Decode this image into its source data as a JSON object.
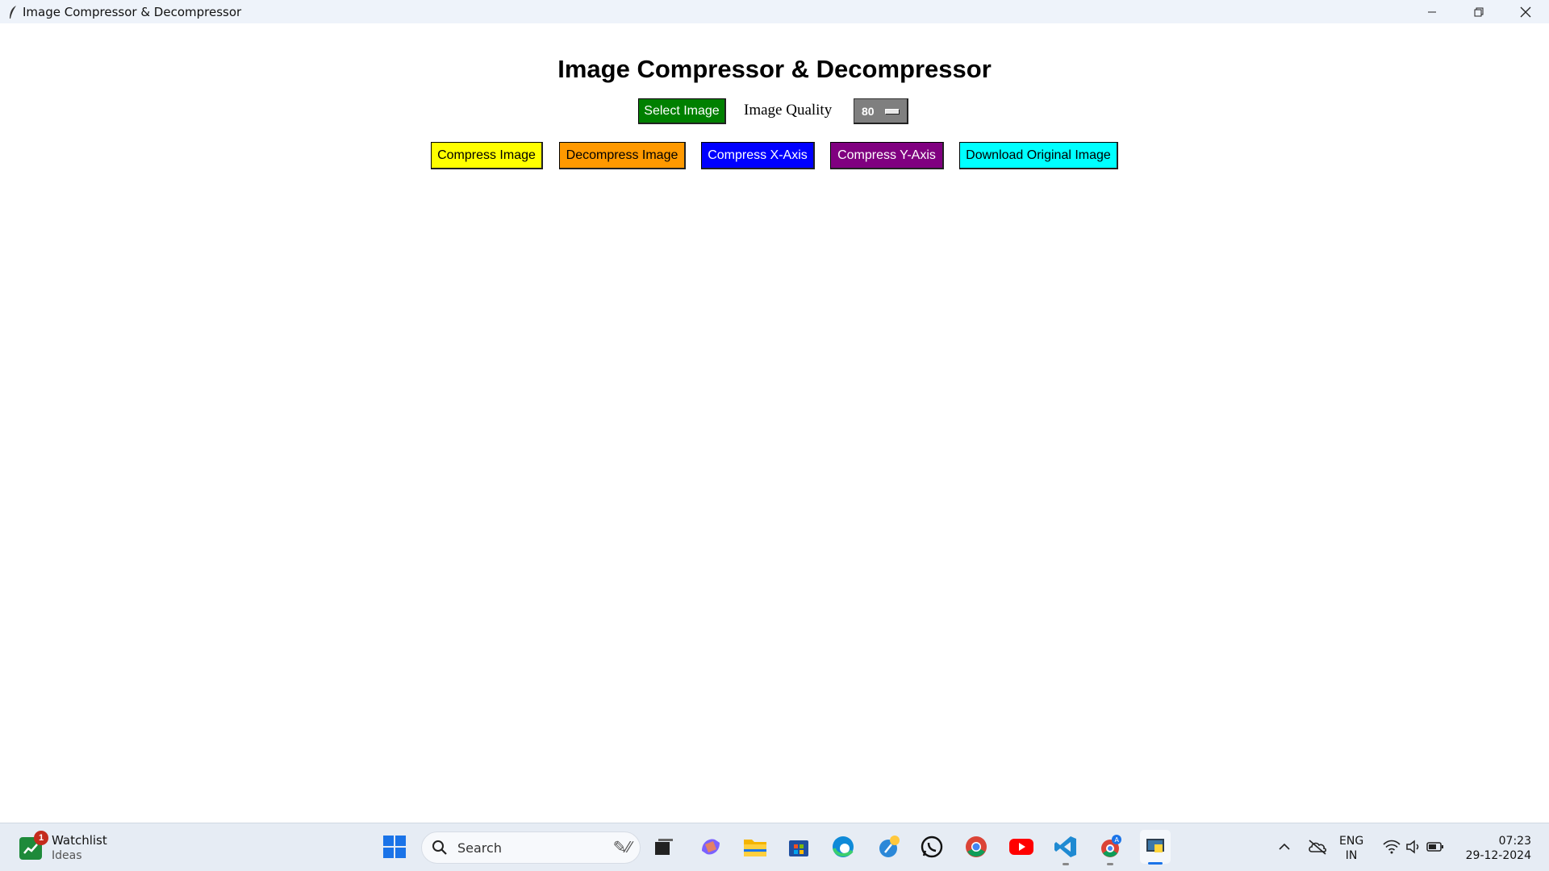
{
  "window": {
    "title": "Image Compressor & Decompressor"
  },
  "app": {
    "heading": "Image Compressor & Decompressor",
    "select_button": "Select Image",
    "quality_label": "Image Quality",
    "quality_value": "80",
    "buttons": [
      {
        "label": "Compress Image",
        "color": "#ffff00"
      },
      {
        "label": "Decompress Image",
        "color": "#ff9900"
      },
      {
        "label": "Compress X-Axis",
        "color": "#0000ff"
      },
      {
        "label": "Compress Y-Axis",
        "color": "#800080"
      },
      {
        "label": "Download Original Image",
        "color": "#00ffff"
      }
    ]
  },
  "taskbar": {
    "widget_title": "Watchlist",
    "widget_subtitle": "Ideas",
    "widget_badge": "1",
    "search_placeholder": "Search",
    "lang_top": "ENG",
    "lang_bottom": "IN",
    "time": "07:23",
    "date": "29-12-2024"
  }
}
